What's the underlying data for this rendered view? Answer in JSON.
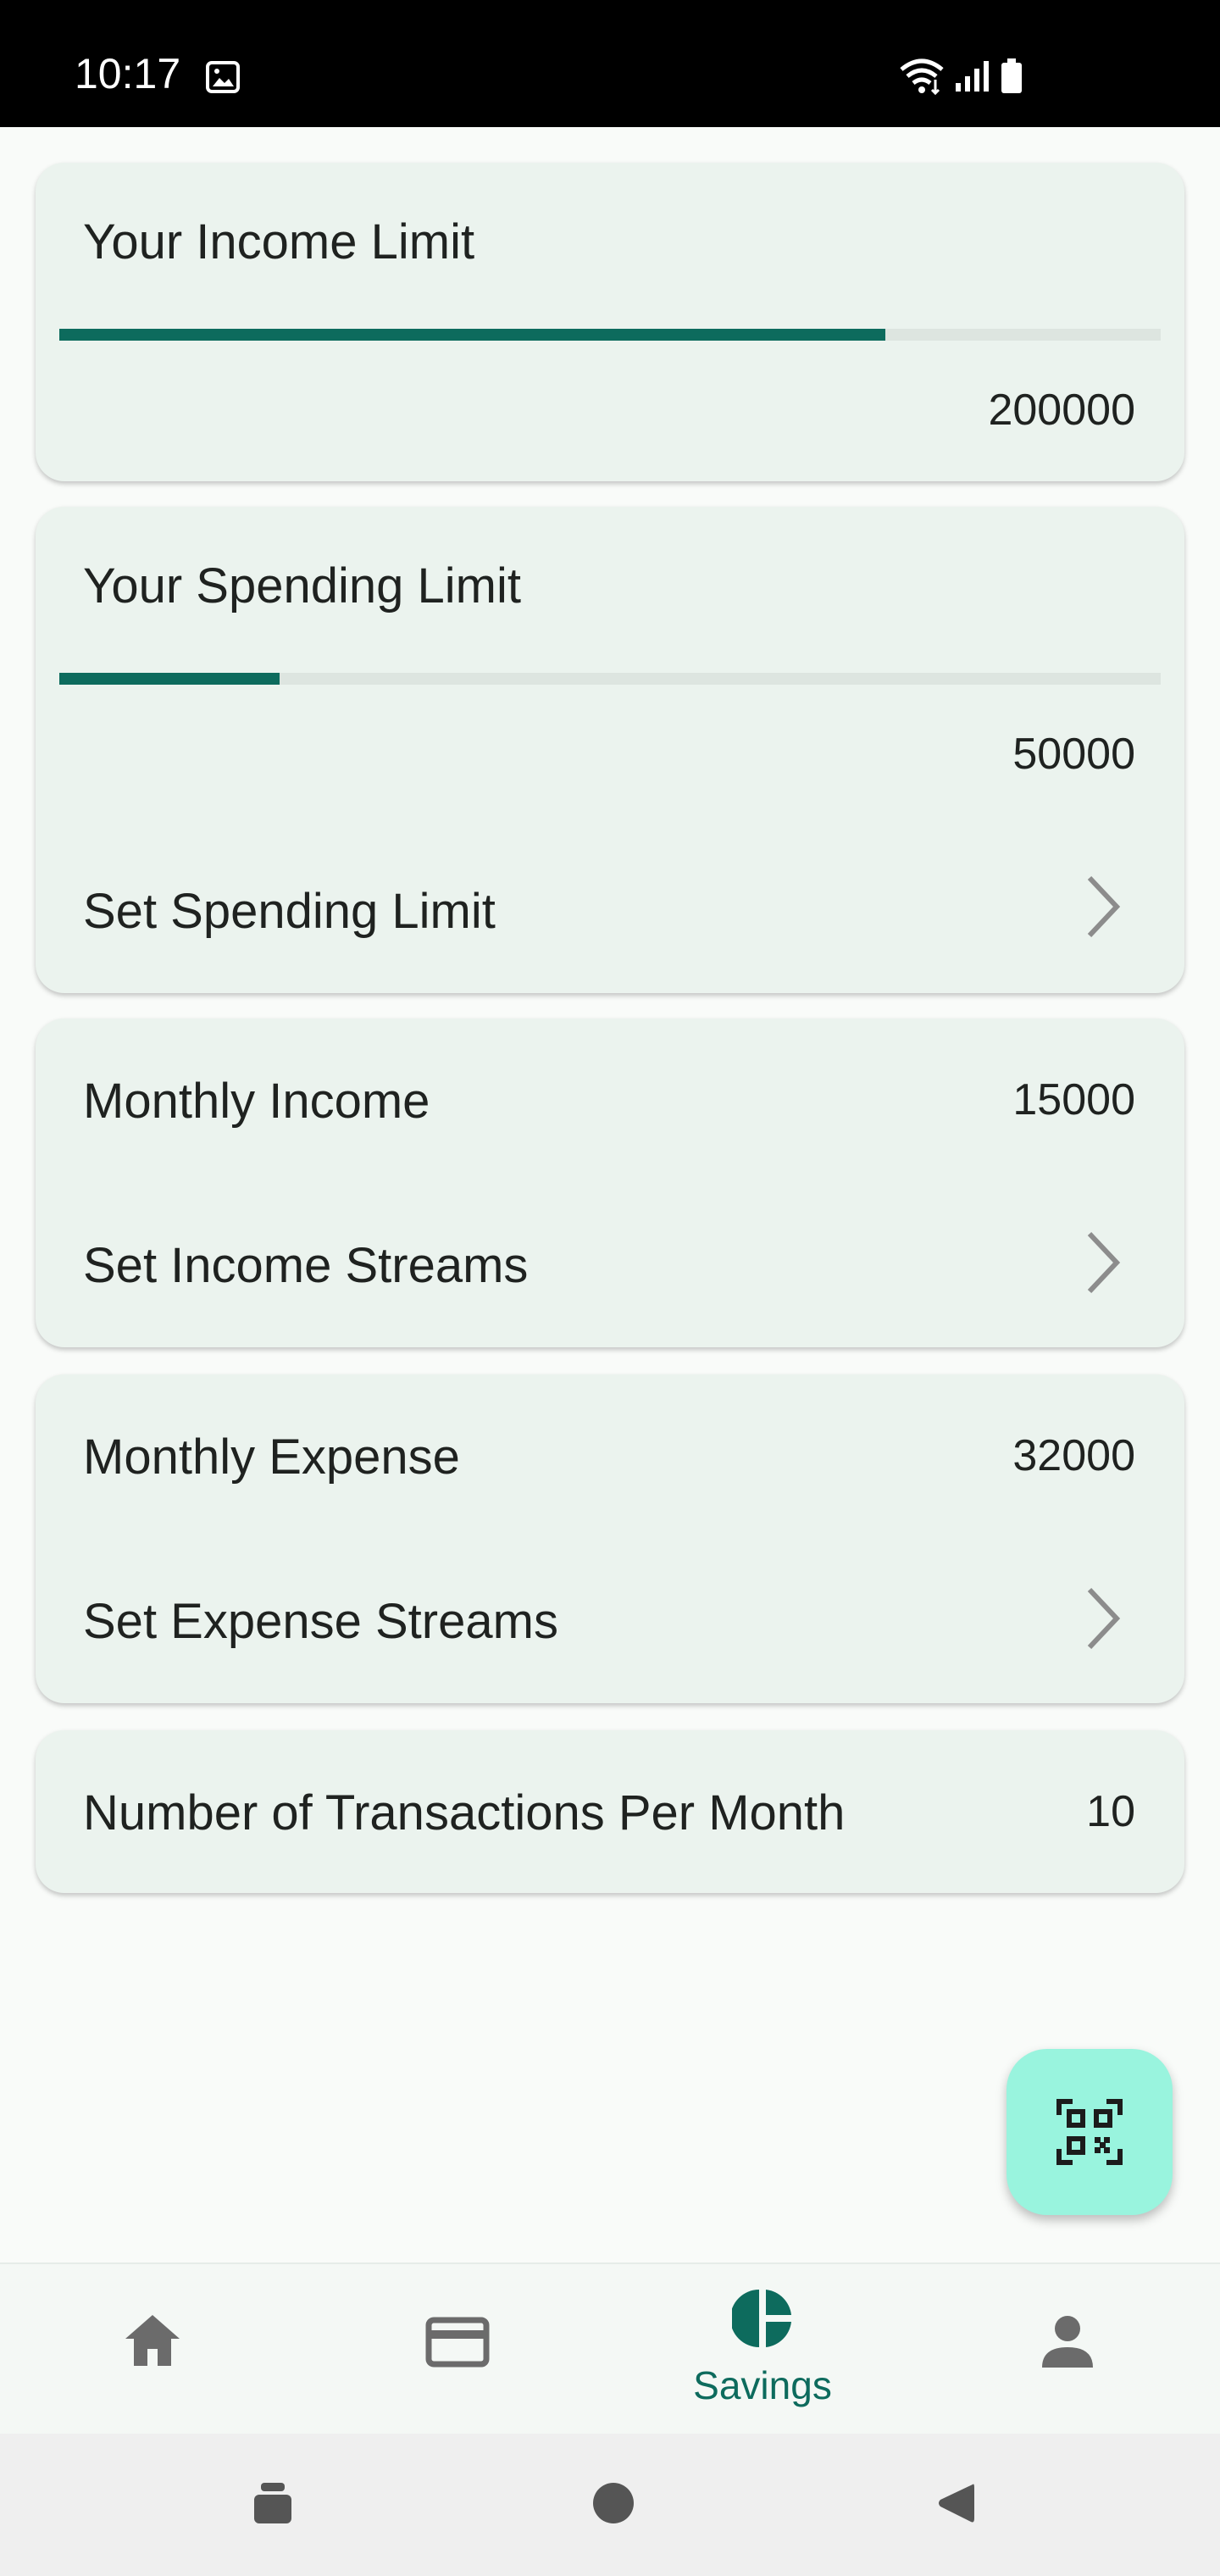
{
  "status_bar": {
    "time": "10:17"
  },
  "income_limit_card": {
    "title": "Your Income Limit",
    "value": "200000",
    "progress": 0.75
  },
  "spending_limit_card": {
    "title": "Your Spending Limit",
    "value": "50000",
    "progress": 0.2,
    "action_label": "Set Spending Limit"
  },
  "income_card": {
    "title": "Monthly Income",
    "value": "15000",
    "action_label": "Set Income Streams"
  },
  "expense_card": {
    "title": "Monthly Expense",
    "value": "32000",
    "action_label": "Set Expense Streams"
  },
  "transactions_card": {
    "title": "Number of Transactions Per Month",
    "value": "10"
  },
  "fab": {
    "icon": "qr-scan-icon"
  },
  "bottom_nav": {
    "items": [
      {
        "icon": "home-icon",
        "label": ""
      },
      {
        "icon": "credit-card-icon",
        "label": ""
      },
      {
        "icon": "pie-chart-icon",
        "label": "Savings",
        "active": true
      },
      {
        "icon": "person-icon",
        "label": ""
      }
    ]
  },
  "colors": {
    "accent": "#0d6b5d",
    "card_bg": "#ebf3ee",
    "fab_bg": "#99f4de",
    "inactive_icon": "#6b6b6b"
  }
}
